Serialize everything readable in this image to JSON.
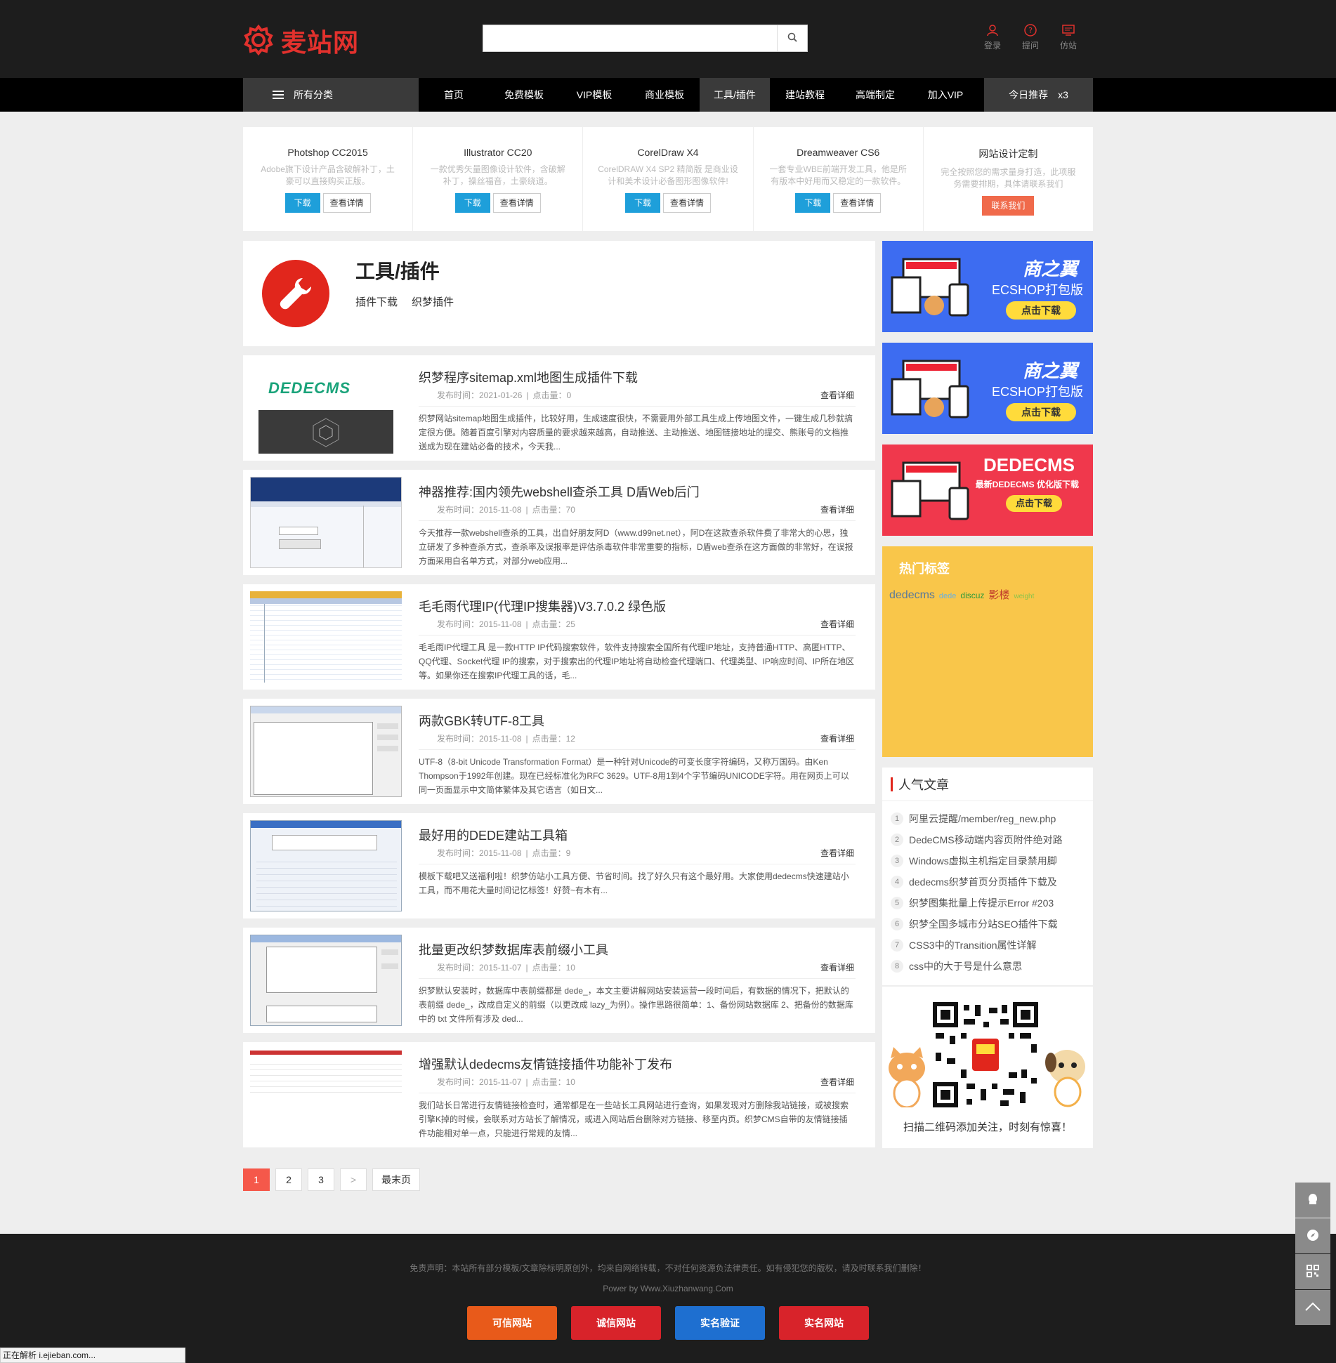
{
  "header": {
    "logo_text": "麦站网",
    "search_placeholder": "",
    "icons": [
      {
        "label": "登录",
        "icon": "user-icon"
      },
      {
        "label": "提问",
        "icon": "question-icon"
      },
      {
        "label": "仿站",
        "icon": "monitor-icon"
      }
    ]
  },
  "nav": {
    "all_label": "所有分类",
    "items": [
      "首页",
      "免费模板",
      "VIP模板",
      "商业模板",
      "工具/插件",
      "建站教程",
      "高端制定",
      "加入VIP"
    ],
    "active_index": 4,
    "today_label": "今日推荐",
    "today_count": "x3"
  },
  "software": [
    {
      "title": "Photshop CC2015",
      "desc": "Adobe旗下设计产品含破解补丁，土豪可以直接购买正版。",
      "dl": "下载",
      "detail": "查看详情"
    },
    {
      "title": "Illustrator CC20",
      "desc": "一款优秀矢量图像设计软件，含破解补丁，操丝福音，土豪绕道。",
      "dl": "下载",
      "detail": "查看详情"
    },
    {
      "title": "CorelDraw X4",
      "desc": "CorelDRAW X4 SP2 精简版 是商业设计和美术设计必备图形图像软件!",
      "dl": "下载",
      "detail": "查看详情"
    },
    {
      "title": "Dreamweaver CS6",
      "desc": "一套专业WBE前端开发工具，他是所有版本中好用而又稳定的一款软件。",
      "dl": "下载",
      "detail": "查看详情"
    },
    {
      "title": "网站设计定制",
      "desc": "完全按照您的需求量身打造，此项服务需要排期，具体请联系我们",
      "contact": "联系我们"
    }
  ],
  "category": {
    "title": "工具/插件",
    "tags": [
      "插件下载",
      "织梦插件"
    ]
  },
  "articles": [
    {
      "title": "织梦程序sitemap.xml地图生成插件下载",
      "date": "发布时间：2021-01-26",
      "views": "点击量：0",
      "more": "查看详细",
      "desc": "织梦网站sitemap地图生成插件，比较好用，生成速度很快，不需要用外部工具生成上传地图文件，一键生成几秒就搞定很方便。随着百度引擎对内容质量的要求越来越高，自动推送、主动推送、地图链接地址的提交、熊账号的文档推送成为现在建站必备的技术，今天我..."
    },
    {
      "title": "神器推荐:国内领先webshell查杀工具 D盾Web后门",
      "date": "发布时间：2015-11-08",
      "views": "点击量：70",
      "more": "查看详细",
      "desc": "今天推荐一款webshell查杀的工具，出自好朋友阿D（www.d99net.net），阿D在这款查杀软件费了非常大的心思，独立研发了多种查杀方式，查杀率及误报率是评估杀毒软件非常重要的指标，D盾web查杀在这方面做的非常好，在误报 方面采用白名单方式，对部分web应用..."
    },
    {
      "title": "毛毛雨代理IP(代理IP搜集器)V3.7.0.2 绿色版",
      "date": "发布时间：2015-11-08",
      "views": "点击量：25",
      "more": "查看详细",
      "desc": "毛毛雨IP代理工具 是一款HTTP IP代码搜索软件，软件支持搜索全国所有代理IP地址，支持普通HTTP、高匿HTTP、QQ代理、Socket代理 IP的搜索，对于搜索出的代理IP地址将自动检查代理端口、代理类型、IP响应时间、IP所在地区等。如果你还在搜索IP代理工具的话，毛..."
    },
    {
      "title": "两款GBK转UTF-8工具",
      "date": "发布时间：2015-11-08",
      "views": "点击量：12",
      "more": "查看详细",
      "desc": "UTF-8（8-bit Unicode Transformation Format）是一种针对Unicode的可变长度字符编码，又称万国码。由Ken Thompson于1992年创建。现在已经标准化为RFC 3629。UTF-8用1到4个字节编码UNICODE字符。用在网页上可以同一页面显示中文简体繁体及其它语言（如日文..."
    },
    {
      "title": "最好用的DEDE建站工具箱",
      "date": "发布时间：2015-11-08",
      "views": "点击量：9",
      "more": "查看详细",
      "desc": "模板下载吧又送福利啦！织梦仿站小工具方便、节省时间。找了好久只有这个最好用。大家使用dedecms快速建站小工具，而不用花大量时间记忆标签！好赞~有木有..."
    },
    {
      "title": "批量更改织梦数据库表前缀小工具",
      "date": "发布时间：2015-11-07",
      "views": "点击量：10",
      "more": "查看详细",
      "desc": "织梦默认安装时，数据库中表前缀都是 dede_，本文主要讲解网站安装运营一段时间后，有数据的情况下，把默认的表前缀 dede_，改成自定义的前缀（以更改成 lazy_为例）。操作思路很简单：1、备份网站数据库 2、把备份的数据库中的 txt 文件所有涉及 ded..."
    },
    {
      "title": "增强默认dedecms友情链接插件功能补丁发布",
      "date": "发布时间：2015-11-07",
      "views": "点击量：10",
      "more": "查看详细",
      "desc": "我们站长日常进行友情链接检查时，通常都是在一些站长工具网站进行查询，如果发现对方删除我站链接，或被搜索引擎K掉的时候，会联系对方站长了解情况，或进入网站后台删除对方链接、移至内页。织梦CMS自带的友情链接插件功能相对单一点，只能进行常规的友情..."
    }
  ],
  "thumb_labels": {
    "dedecms": "DEDECMS"
  },
  "pagination": {
    "pages": [
      "1",
      "2",
      "3"
    ],
    "next": ">",
    "last": "最末页"
  },
  "ads": [
    {
      "brand": "商之翼",
      "sub": "ECSHOP打包版",
      "btn": "点击下载",
      "color": "#3d6cf1"
    },
    {
      "brand": "商之翼",
      "sub": "ECSHOP打包版",
      "btn": "点击下载",
      "color": "#3d6cf1"
    },
    {
      "brand": "DEDECMS",
      "sub": "最新DEDECMS 优化版下载",
      "btn": "点击下载",
      "color": "#f0384c"
    }
  ],
  "hot_tags": {
    "title": "热门标签",
    "tags": [
      {
        "text": "dedecms",
        "color": "#5a7a99",
        "size": 16
      },
      {
        "text": "dede",
        "color": "#6ab0e0",
        "size": 11
      },
      {
        "text": "discuz",
        "color": "#2d9a3a",
        "size": 12
      },
      {
        "text": "影楼",
        "color": "#c0392b",
        "size": 15
      },
      {
        "text": "weight",
        "color": "#8bc34a",
        "size": 10
      }
    ]
  },
  "popular": {
    "title": "人气文章",
    "items": [
      "阿里云提醒/member/reg_new.php",
      "DedeCMS移动端内容页附件绝对路",
      "Windows虚拟主机指定目录禁用脚",
      "dedecms织梦首页分页插件下载及",
      "织梦图集批量上传提示Error #203",
      "织梦全国多城市分站SEO插件下载",
      "CSS3中的Transition属性详解",
      "css中的大于号是什么意思"
    ]
  },
  "qr": {
    "text": "扫描二维码添加关注，时刻有惊喜！"
  },
  "footer": {
    "disclaimer": "免责声明：本站所有部分模板/文章除标明原创外，均来自网络转载，不对任何资源负法律责任。如有侵犯您的版权，请及时联系我们删除！",
    "power": "Power by Www.Xiuzhanwang.Com",
    "badges": [
      {
        "label": "可信网站",
        "color": "#e85a1a"
      },
      {
        "label": "诚信网站",
        "color": "#d8232a"
      },
      {
        "label": "实名验证",
        "color": "#1e6fd0"
      },
      {
        "label": "实名网站",
        "color": "#d8232a"
      }
    ]
  },
  "status_bar": "正在解析 i.ejieban.com..."
}
